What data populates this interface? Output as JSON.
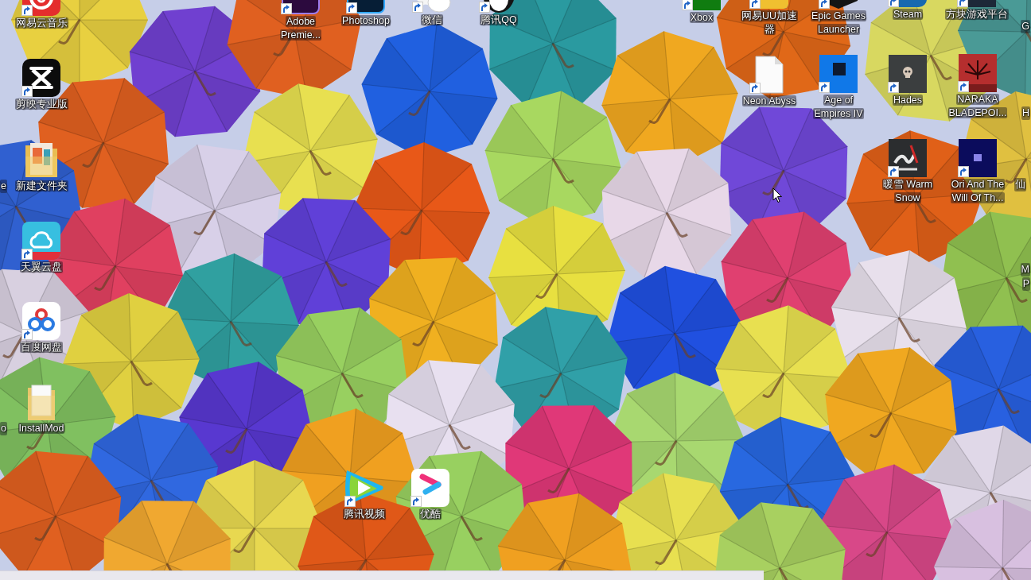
{
  "desktop": {
    "icons": [
      {
        "label": "网易云音乐",
        "shortcut": true
      },
      {
        "label": "Adobe Premie...",
        "shortcut": true
      },
      {
        "label": "Photoshop",
        "shortcut": true
      },
      {
        "label": "微信",
        "shortcut": true
      },
      {
        "label": "腾讯QQ",
        "shortcut": true
      },
      {
        "label": "Xbox",
        "shortcut": true
      },
      {
        "label": "网易UU加速器",
        "shortcut": true
      },
      {
        "label": "Epic Games Launcher",
        "shortcut": true
      },
      {
        "label": "Steam",
        "shortcut": true
      },
      {
        "label": "方块游戏平台",
        "shortcut": true
      },
      {
        "label": "剪映专业版",
        "shortcut": true
      },
      {
        "label": "Neon Abyss",
        "shortcut": true
      },
      {
        "label": "Age of Empires IV",
        "shortcut": true
      },
      {
        "label": "Hades",
        "shortcut": true
      },
      {
        "label": "NARAKA BLADEPOI...",
        "shortcut": true
      },
      {
        "label": "新建文件夹",
        "shortcut": false
      },
      {
        "label": "暖雪 Warm Snow",
        "shortcut": true
      },
      {
        "label": "Ori And The Will Of Th...",
        "shortcut": true
      },
      {
        "label": "天翼云盘",
        "shortcut": true
      },
      {
        "label": "百度网盘",
        "shortcut": true
      },
      {
        "label": "InstallMod",
        "shortcut": false
      },
      {
        "label": "腾讯视频",
        "shortcut": true
      },
      {
        "label": "优酷",
        "shortcut": true
      }
    ],
    "edge_labels": [
      {
        "label": "G"
      },
      {
        "label": "H"
      },
      {
        "label": "e"
      },
      {
        "label": "仙"
      },
      {
        "label": "M"
      },
      {
        "label": "P"
      },
      {
        "label": "o"
      }
    ]
  }
}
